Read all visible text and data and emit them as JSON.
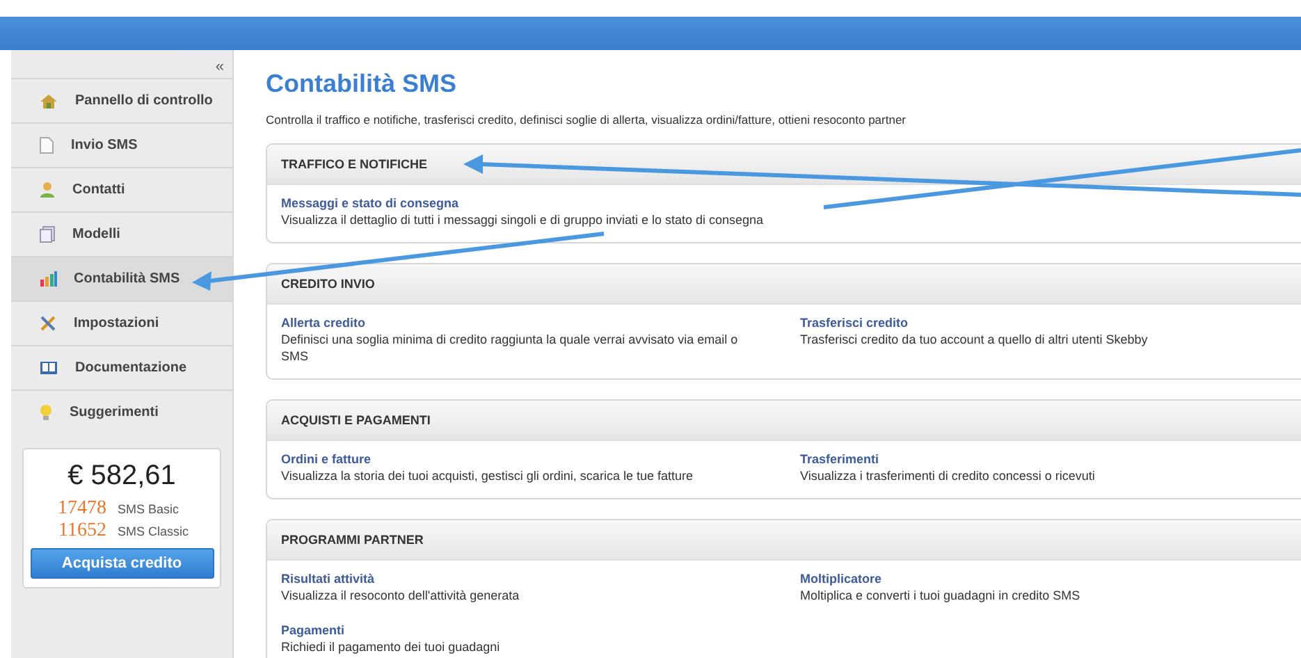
{
  "sidebar": {
    "collapse": "«",
    "items": [
      {
        "label": "Pannello di controllo",
        "selected": false
      },
      {
        "label": "Invio SMS",
        "selected": false
      },
      {
        "label": "Contatti",
        "selected": false
      },
      {
        "label": "Modelli",
        "selected": false
      },
      {
        "label": "Contabilità SMS",
        "selected": true
      },
      {
        "label": "Impostazioni",
        "selected": false
      },
      {
        "label": "Documentazione",
        "selected": false
      },
      {
        "label": "Suggerimenti",
        "selected": false
      }
    ],
    "balance": {
      "amount": "€ 582,61",
      "credits": [
        {
          "count": "17478",
          "label": "SMS Basic"
        },
        {
          "count": "11652",
          "label": "SMS Classic"
        }
      ],
      "button": "Acquista credito"
    }
  },
  "page": {
    "title": "Contabilità SMS",
    "description": "Controlla il traffico e notifiche, trasferisci credito, definisci soglie di allerta, visualizza ordini/fatture, ottieni resoconto partner"
  },
  "sections": [
    {
      "title": "TRAFFICO E NOTIFICHE",
      "items": [
        {
          "title": "Messaggi e stato di consegna",
          "text": "Visualizza il dettaglio di tutti i messaggi singoli e di gruppo inviati e lo stato di consegna"
        }
      ]
    },
    {
      "title": "CREDITO INVIO",
      "items": [
        {
          "title": "Allerta credito",
          "text": "Definisci una soglia minima di credito raggiunta la quale verrai avvisato via email o SMS"
        },
        {
          "title": "Trasferisci credito",
          "text": "Trasferisci credito da tuo account a quello di altri utenti Skebby"
        }
      ]
    },
    {
      "title": "ACQUISTI E PAGAMENTI",
      "items": [
        {
          "title": "Ordini e fatture",
          "text": "Visualizza la storia dei tuoi acquisti, gestisci gli ordini, scarica le tue fatture"
        },
        {
          "title": "Trasferimenti",
          "text": "Visualizza i trasferimenti di credito concessi o ricevuti"
        }
      ]
    },
    {
      "title": "PROGRAMMI PARTNER",
      "items": [
        {
          "title": "Risultati attività",
          "text": "Visualizza il resoconto dell'attività generata"
        },
        {
          "title": "Moltiplicatore",
          "text": "Moltiplica e converti i tuoi guadagni in credito SMS"
        },
        {
          "title": "Pagamenti",
          "text": "Richiedi il pagamento dei tuoi guadagni"
        }
      ]
    }
  ]
}
